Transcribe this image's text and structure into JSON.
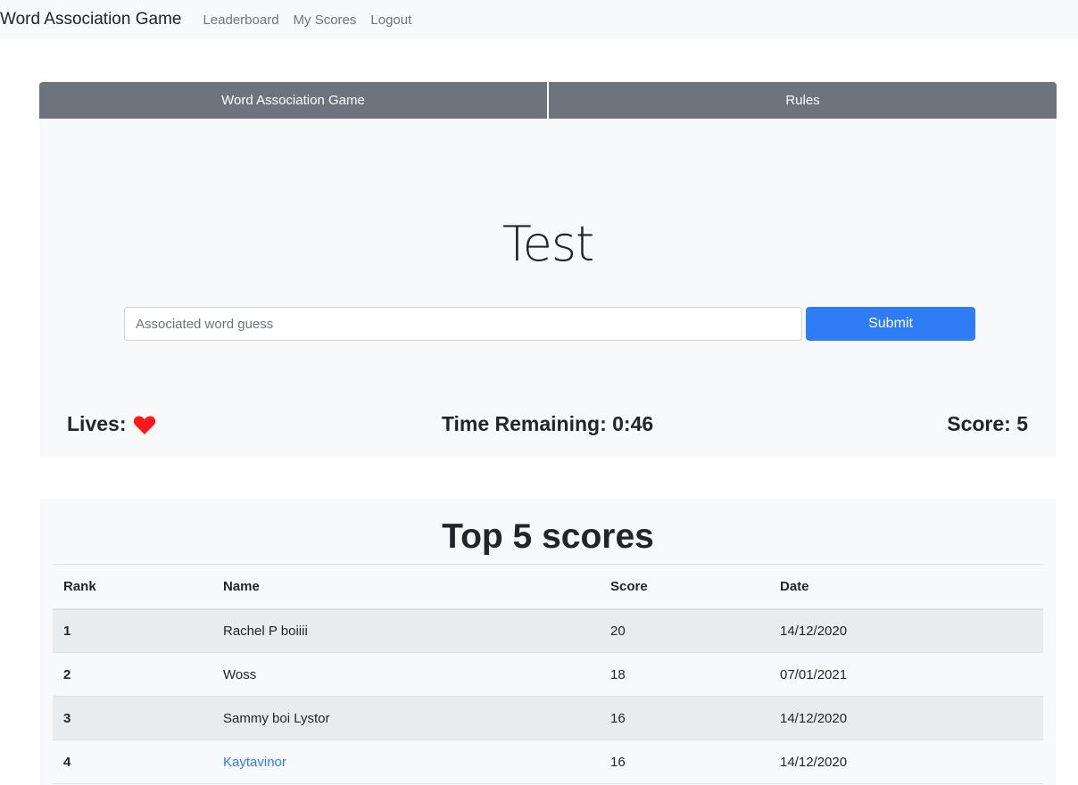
{
  "navbar": {
    "brand": "Word Association Game",
    "links": [
      "Leaderboard",
      "My Scores",
      "Logout"
    ]
  },
  "game": {
    "tabs": [
      "Word Association Game",
      "Rules"
    ],
    "word": "Test",
    "input_placeholder": "Associated word guess",
    "input_value": "",
    "submit_label": "Submit",
    "lives_label": "Lives:",
    "lives_count": 1,
    "time_label": "Time Remaining: 0:46",
    "score_label": "Score: 5"
  },
  "leaderboard": {
    "title": "Top 5 scores",
    "columns": [
      "Rank",
      "Name",
      "Score",
      "Date"
    ],
    "rows": [
      {
        "rank": "1",
        "name": "Rachel P boiiii",
        "score": "20",
        "date": "14/12/2020",
        "link": false
      },
      {
        "rank": "2",
        "name": "Woss",
        "score": "18",
        "date": "07/01/2021",
        "link": false
      },
      {
        "rank": "3",
        "name": "Sammy boi Lystor",
        "score": "16",
        "date": "14/12/2020",
        "link": false
      },
      {
        "rank": "4",
        "name": "Kaytavinor",
        "score": "16",
        "date": "14/12/2020",
        "link": true
      }
    ]
  },
  "colors": {
    "accent": "#2e7cf6",
    "tab_bg": "#6c757d",
    "heart": "#ff1a1a"
  }
}
